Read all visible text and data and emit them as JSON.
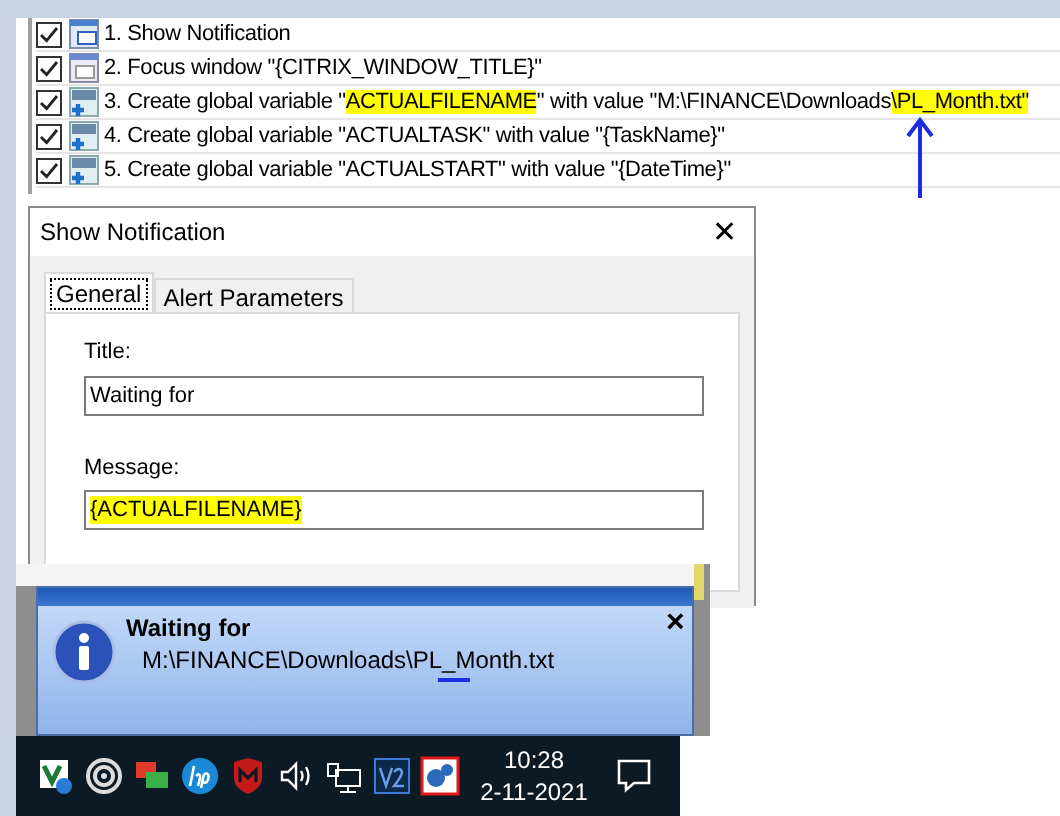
{
  "steps": [
    {
      "checked": true,
      "kind": "notification",
      "parts": [
        {
          "text": "1. Show Notification",
          "highlight": false
        }
      ]
    },
    {
      "checked": true,
      "kind": "window",
      "parts": [
        {
          "text": "2. Focus window \"{CITRIX_WINDOW_TITLE}\"",
          "highlight": false
        }
      ]
    },
    {
      "checked": true,
      "kind": "variable",
      "parts": [
        {
          "text": "3. Create global variable \"",
          "highlight": false
        },
        {
          "text": "ACTUALFILENAME",
          "highlight": true
        },
        {
          "text": "\" with value \"M:\\FINANCE\\Downloads",
          "highlight": false
        },
        {
          "text": "\\PL_Month.txt\"",
          "highlight": true
        }
      ]
    },
    {
      "checked": true,
      "kind": "variable",
      "parts": [
        {
          "text": "4. Create global variable \"ACTUALTASK\" with value \"{TaskName}\"",
          "highlight": false
        }
      ]
    },
    {
      "checked": true,
      "kind": "variable",
      "parts": [
        {
          "text": "5. Create global variable \"ACTUALSTART\" with value \"{DateTime}\"",
          "highlight": false
        }
      ]
    }
  ],
  "dialog": {
    "title": "Show Notification",
    "close": "✕",
    "tabs": [
      {
        "label": "General",
        "selected": true
      },
      {
        "label": "Alert Parameters",
        "selected": false
      }
    ],
    "fields": [
      {
        "label": "Title:",
        "value": "Waiting for",
        "highlight": false
      },
      {
        "label": "Message:",
        "value": "{ACTUALFILENAME}",
        "highlight": true
      }
    ]
  },
  "balloon": {
    "title": "Waiting for",
    "message": "M:\\FINANCE\\Downloads\\PL_Month.txt",
    "close": "×"
  },
  "taskbar": {
    "time": "10:28",
    "date": "2-11-2021"
  }
}
